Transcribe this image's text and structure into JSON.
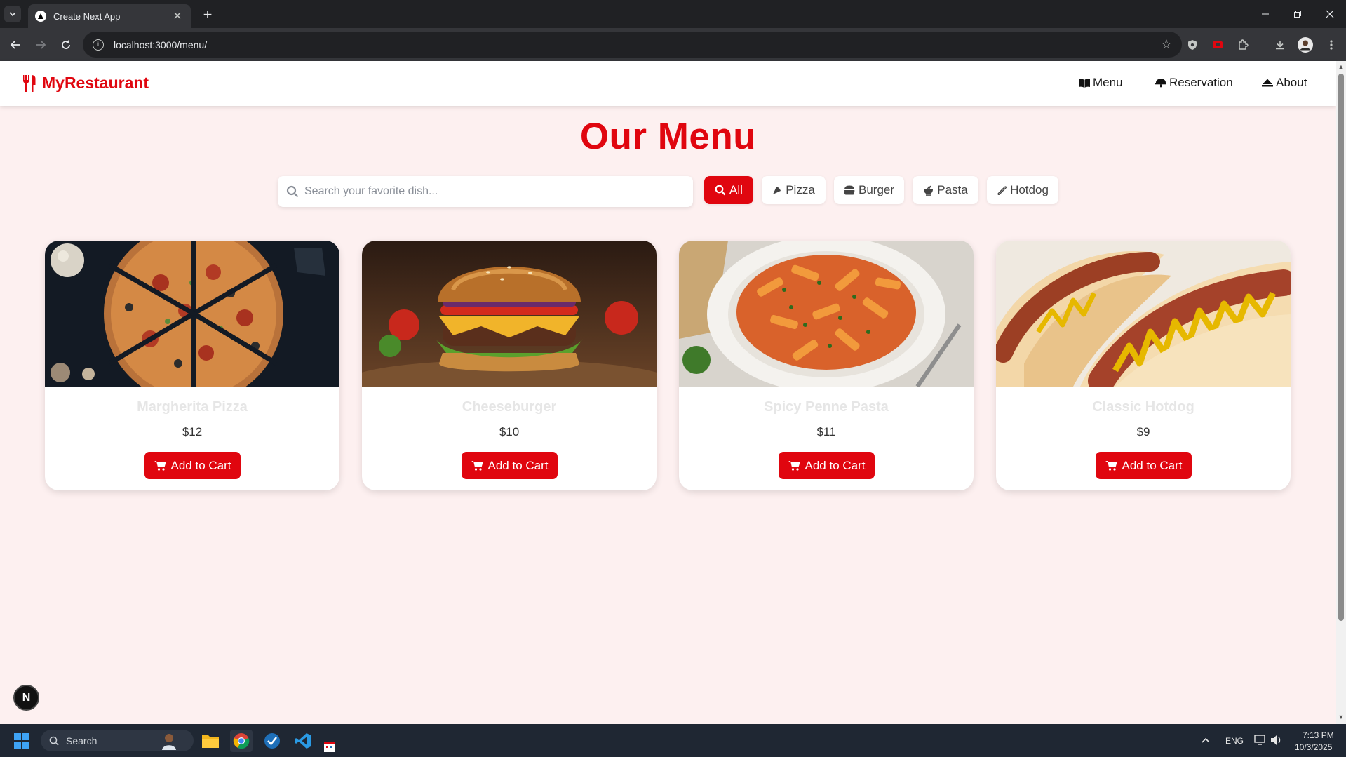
{
  "browser": {
    "tab_title": "Create Next App",
    "url": "localhost:3000/menu/"
  },
  "navbar": {
    "brand": "MyRestaurant",
    "items": [
      {
        "label": "Menu",
        "icon": "book-icon"
      },
      {
        "label": "Reservation",
        "icon": "cloche-icon"
      },
      {
        "label": "About",
        "icon": "info-icon"
      }
    ]
  },
  "page": {
    "title": "Our Menu",
    "search_placeholder": "Search your favorite dish..."
  },
  "filters": [
    {
      "label": "All",
      "icon": "search-icon",
      "active": true
    },
    {
      "label": "Pizza",
      "icon": "pizza-icon",
      "active": false
    },
    {
      "label": "Burger",
      "icon": "burger-icon",
      "active": false
    },
    {
      "label": "Pasta",
      "icon": "pasta-icon",
      "active": false
    },
    {
      "label": "Hotdog",
      "icon": "hotdog-icon",
      "active": false
    }
  ],
  "menu_items": [
    {
      "name": "Margherita Pizza",
      "price": "$12",
      "button": "Add to Cart"
    },
    {
      "name": "Cheeseburger",
      "price": "$10",
      "button": "Add to Cart"
    },
    {
      "name": "Spicy Penne Pasta",
      "price": "$11",
      "button": "Add to Cart"
    },
    {
      "name": "Classic Hotdog",
      "price": "$9",
      "button": "Add to Cart"
    }
  ],
  "dev_badge": "N",
  "taskbar": {
    "search_label": "Search",
    "language": "ENG",
    "time": "7:13 PM",
    "date": "10/3/2025"
  },
  "colors": {
    "accent": "#e0060f",
    "page_background": "#fdf0f0"
  }
}
